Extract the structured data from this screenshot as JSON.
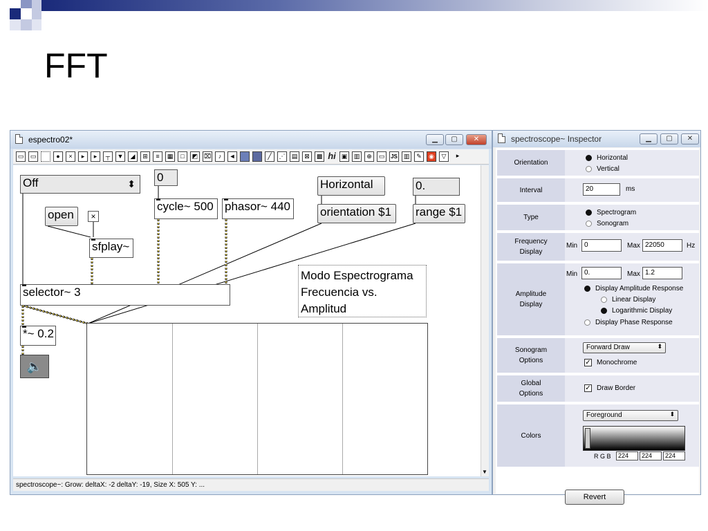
{
  "slide": {
    "title": "FFT"
  },
  "patcher": {
    "window_title": "espectro02*",
    "status_text": "spectroscope~: Grow: deltaX: -2 deltaY: -19, Size X: 505 Y: ...",
    "toolbar_labels": {
      "hi": "hi",
      "js": "JS"
    },
    "objects": {
      "menu_off": "Off",
      "num_zero": "0",
      "open_msg": "open",
      "sfplay": "sfplay~",
      "cycle": "cycle~ 500",
      "phasor": "phasor~ 440",
      "horizontal_msg": "Horizontal",
      "orientation_msg": "orientation $1",
      "num_float": "0.",
      "range_msg": "range $1",
      "selector": "selector~ 3",
      "gain": "*~ 0.2",
      "toggle_mark": "×"
    },
    "comment": {
      "line1": "Modo Espectrograma",
      "line2": "Frecuencia vs.",
      "line3": "Amplitud"
    }
  },
  "inspector": {
    "window_title": "spectroscope~ Inspector",
    "orientation": {
      "label": "Orientation",
      "opt1": "Horizontal",
      "opt2": "Vertical",
      "selected": "Horizontal"
    },
    "interval": {
      "label": "Interval",
      "value": "20",
      "unit": "ms"
    },
    "type": {
      "label": "Type",
      "opt1": "Spectrogram",
      "opt2": "Sonogram",
      "selected": "Spectrogram"
    },
    "frequency": {
      "label1": "Frequency",
      "label2": "Display",
      "min_label": "Min",
      "min_value": "0",
      "max_label": "Max",
      "max_value": "22050",
      "unit": "Hz"
    },
    "amplitude": {
      "label1": "Amplitude",
      "label2": "Display",
      "min_label": "Min",
      "min_value": "0.",
      "max_label": "Max",
      "max_value": "1.2",
      "opt_amp": "Display Amplitude Response",
      "opt_linear": "Linear Display",
      "opt_log": "Logarithmic Display",
      "opt_phase": "Display Phase Response"
    },
    "sonogram": {
      "label1": "Sonogram",
      "label2": "Options",
      "draw_mode": "Forward Draw",
      "mono_label": "Monochrome",
      "mono_checked": true
    },
    "global": {
      "label1": "Global",
      "label2": "Options",
      "border_label": "Draw Border",
      "border_checked": true
    },
    "colors": {
      "label": "Colors",
      "target": "Foreground",
      "rgb_label": "R G B",
      "r": "224",
      "g": "224",
      "b": "224"
    },
    "revert_label": "Revert",
    "check_mark": "✓"
  },
  "colors": {
    "accent": "#1a2a7a",
    "window_frame": "#d7e4f2",
    "section_bg": "#d6d9e8"
  }
}
